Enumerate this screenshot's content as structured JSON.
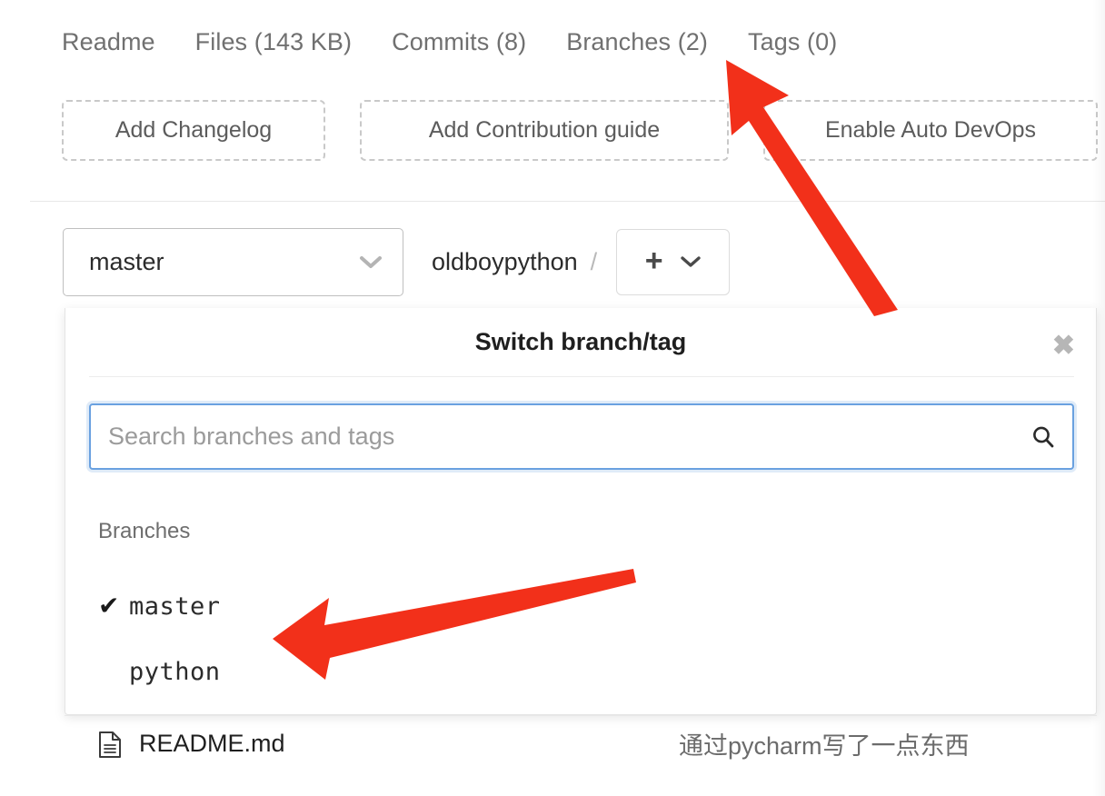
{
  "repo_nav": {
    "items": [
      {
        "label": "Readme",
        "name": "nav-readme"
      },
      {
        "label": "Files (143 KB)",
        "name": "nav-files"
      },
      {
        "label": "Commits (8)",
        "name": "nav-commits"
      },
      {
        "label": "Branches (2)",
        "name": "nav-branches"
      },
      {
        "label": "Tags (0)",
        "name": "nav-tags"
      }
    ]
  },
  "quick_actions": [
    {
      "label": "Add Changelog"
    },
    {
      "label": "Add Contribution guide"
    },
    {
      "label": "Enable Auto DevOps"
    }
  ],
  "branch_bar": {
    "current_branch": "master",
    "project_name": "oldboypython",
    "path_separator": "/",
    "add_button": {
      "plus": "+",
      "chevron": "chevron-down"
    }
  },
  "dropdown": {
    "title": "Switch branch/tag",
    "close_label": "✖",
    "search": {
      "value": "",
      "placeholder": "Search branches and tags"
    },
    "group_label": "Branches",
    "branches": [
      {
        "name": "master",
        "selected": true,
        "check": "✔"
      },
      {
        "name": "python",
        "selected": false,
        "check": "✔"
      }
    ]
  },
  "file_row": {
    "icon": "file-text-icon",
    "name": "README.md",
    "commit_message": "通过pycharm写了一点东西"
  },
  "annotations": {
    "accent_color": "#F2301A",
    "arrows": [
      {
        "name": "arrow-to-branches-tab",
        "target": "Branches (2)"
      },
      {
        "name": "arrow-to-branch-list",
        "target": "master / python branch list"
      }
    ]
  }
}
